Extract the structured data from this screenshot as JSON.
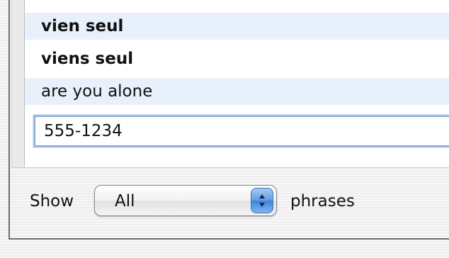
{
  "phrases": {
    "rows": [
      {
        "text": "vien seul"
      },
      {
        "text": "viens seul"
      },
      {
        "text": "are you alone"
      }
    ],
    "editing_value": "555-1234"
  },
  "footer": {
    "show_label": "Show",
    "filter_selected": "All",
    "phrases_label": "phrases"
  },
  "icons": {
    "popup_arrows": "up-down-chevron-icon"
  },
  "colors": {
    "row_alternate": "#e8f0fb",
    "selection_focus": "#85a8d6",
    "popup_accent": "#5e9be3"
  }
}
